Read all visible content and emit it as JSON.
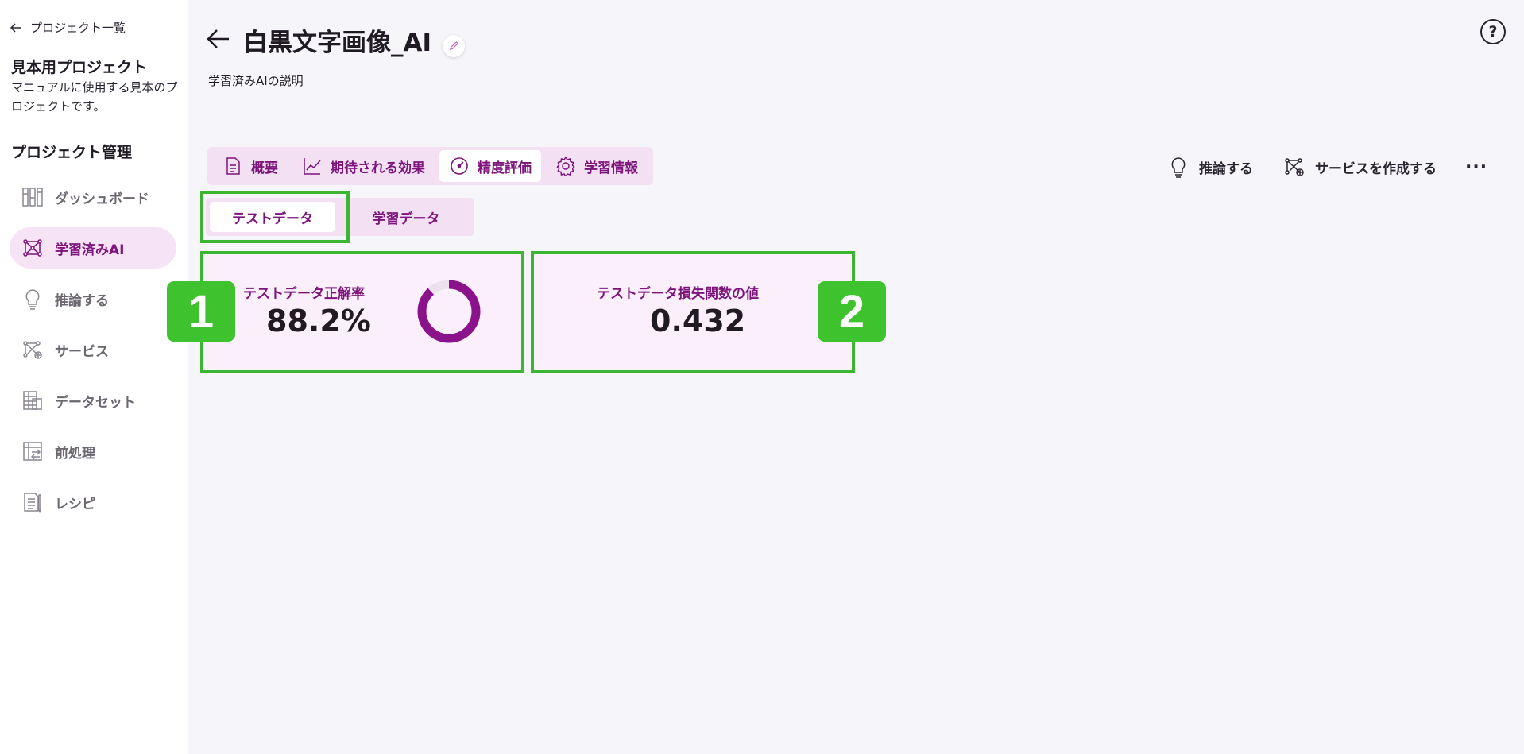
{
  "sidebar": {
    "back_label": "プロジェクト一覧",
    "project_name": "見本用プロジェクト",
    "project_desc": "マニュアルに使用する見本のプロジェクトです。",
    "section_title": "プロジェクト管理",
    "items": [
      {
        "label": "ダッシュボード",
        "icon": "dashboard-icon"
      },
      {
        "label": "学習済みAI",
        "icon": "network-icon",
        "active": true
      },
      {
        "label": "推論する",
        "icon": "lightbulb-icon"
      },
      {
        "label": "サービス",
        "icon": "service-icon"
      },
      {
        "label": "データセット",
        "icon": "dataset-icon"
      },
      {
        "label": "前処理",
        "icon": "preprocess-icon"
      },
      {
        "label": "レシピ",
        "icon": "recipe-icon"
      }
    ]
  },
  "header": {
    "title": "白黒文字画像_AI",
    "subtitle": "学習済みAIの説明",
    "help": "?"
  },
  "tabs": [
    {
      "label": "概要",
      "icon": "document-icon"
    },
    {
      "label": "期待される効果",
      "icon": "chart-line-icon"
    },
    {
      "label": "精度評価",
      "icon": "gauge-icon",
      "active": true
    },
    {
      "label": "学習情報",
      "icon": "gear-icon"
    }
  ],
  "actions": {
    "infer": "推論する",
    "create_service": "サービスを作成する",
    "more": "···"
  },
  "subtabs": [
    {
      "label": "テストデータ",
      "active": true
    },
    {
      "label": "学習データ"
    }
  ],
  "metrics": {
    "accuracy_label": "テストデータ正解率",
    "accuracy_value": "88.2%",
    "accuracy_fraction": 0.882,
    "loss_label": "テストデータ損失関数の値",
    "loss_value": "0.432"
  },
  "annotations": {
    "badge1": "1",
    "badge2": "2"
  },
  "colors": {
    "accent": "#7c147c",
    "highlight": "#3cb531",
    "tab_bg": "#f3e1f3",
    "card_bg": "#fbeffb"
  }
}
